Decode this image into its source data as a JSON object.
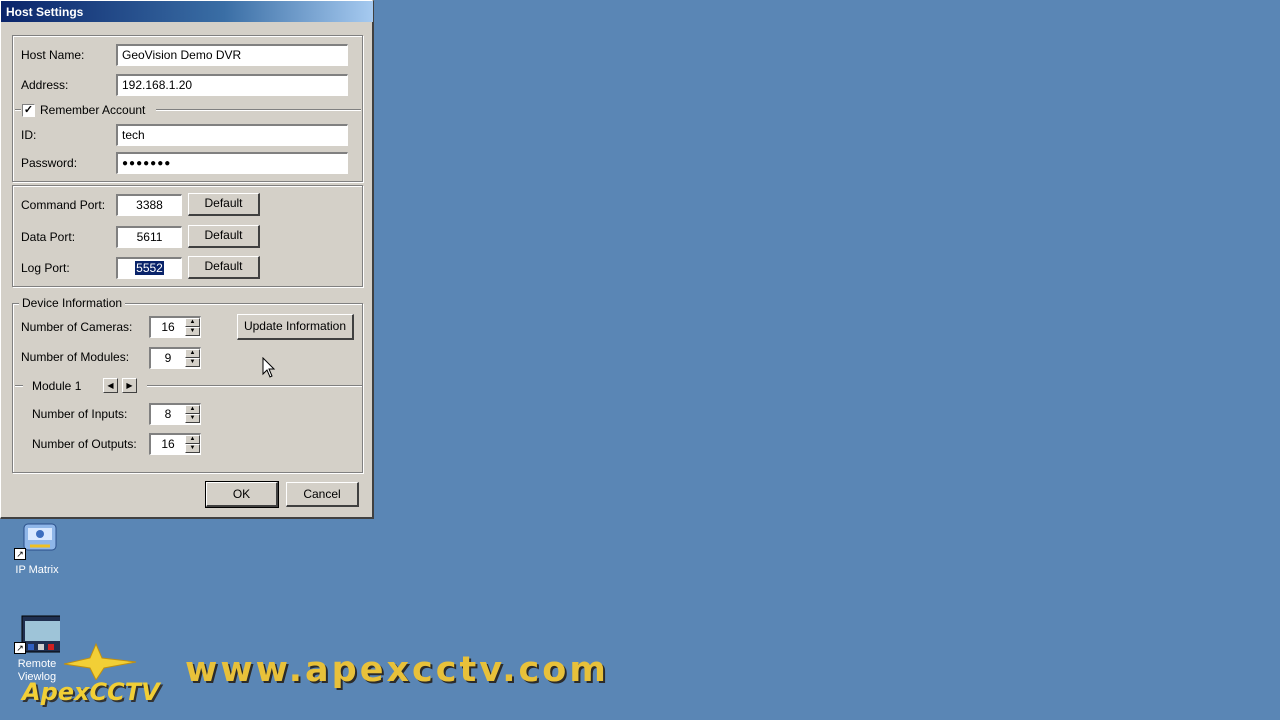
{
  "dialog": {
    "title": "Host Settings",
    "host": {
      "host_name_label": "Host Name:",
      "host_name_value": "GeoVision Demo DVR",
      "address_label": "Address:",
      "address_value": "192.168.1.20"
    },
    "account": {
      "remember_label": "Remember Account",
      "remember_checked": true,
      "check_glyph": "✓",
      "id_label": "ID:",
      "id_value": "tech",
      "password_label": "Password:",
      "password_value": "●●●●●●●"
    },
    "ports": {
      "command_label": "Command Port:",
      "command_value": "3388",
      "data_label": "Data Port:",
      "data_value": "5611",
      "log_label": "Log Port:",
      "log_value": "5552",
      "default_label": "Default"
    },
    "device": {
      "legend": "Device Information",
      "cameras_label": "Number of Cameras:",
      "cameras_value": "16",
      "modules_label": "Number of Modules:",
      "modules_value": "9",
      "update_label": "Update Information",
      "module_label": "Module 1",
      "inputs_label": "Number of Inputs:",
      "inputs_value": "8",
      "outputs_label": "Number of Outputs:",
      "outputs_value": "16"
    },
    "ok_label": "OK",
    "cancel_label": "Cancel"
  },
  "desktop": {
    "icons": [
      {
        "label": "IP Matrix",
        "icon": "ip-matrix-icon"
      },
      {
        "label": "Remote Viewlog",
        "icon": "remote-viewlog-icon"
      }
    ]
  },
  "watermark": {
    "url": "www.apexcctv.com",
    "logo": "ApexCCTV"
  },
  "colors": {
    "desktop": "#5a86b5",
    "dialog": "#d4d0c8",
    "titlebar_start": "#0a246a",
    "selection": "#0a246a",
    "watermark": "#e8c13a"
  }
}
